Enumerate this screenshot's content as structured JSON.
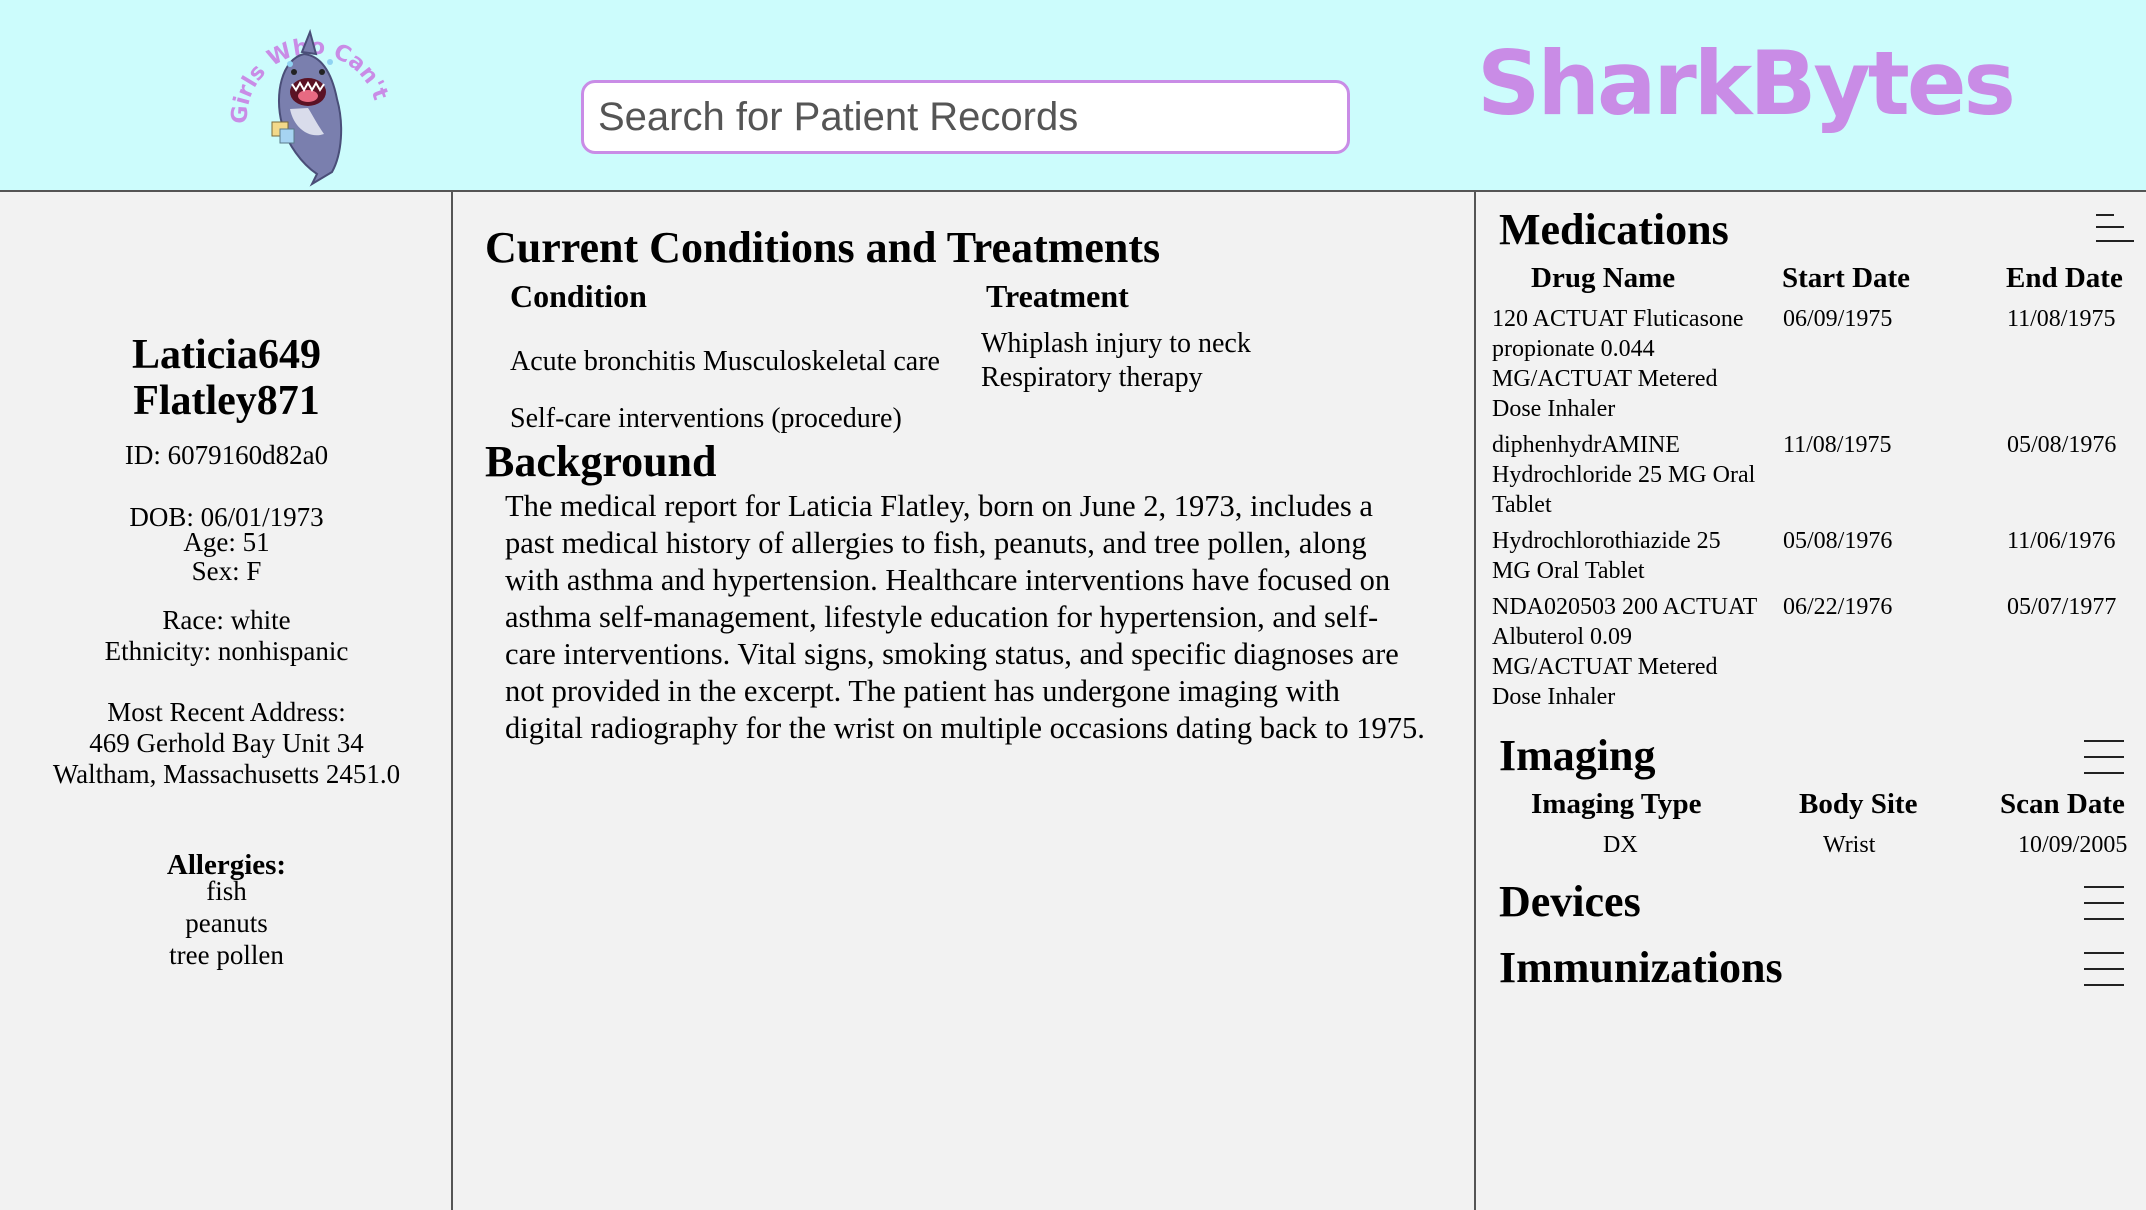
{
  "header": {
    "logo_text": "Girls Who Can't Code",
    "search_placeholder": "Search for Patient Records",
    "brand": "SharkBytes",
    "brand_color": "#c98ce6",
    "background": "#ccfcfc"
  },
  "patient": {
    "name_line1": "Laticia649",
    "name_line2": "Flatley871",
    "id": "ID: 6079160d82a0",
    "dob": "DOB: 06/01/1973",
    "age": "Age: 51",
    "sex": "Sex: F",
    "race": "Race: white",
    "ethnicity": "Ethnicity: nonhispanic",
    "address_label": "Most Recent Address:",
    "address_line1": "469 Gerhold Bay Unit 34",
    "address_line2": "Waltham, Massachusetts 2451.0",
    "allergies_label": "Allergies:",
    "allergies": [
      "fish",
      "peanuts",
      "tree pollen"
    ]
  },
  "conditions": {
    "title": "Current Conditions and Treatments",
    "col_condition": "Condition",
    "col_treatment": "Treatment",
    "condition_1": "Acute bronchitis Musculoskeletal care",
    "treatment_1a": "Whiplash injury to neck",
    "treatment_1b": "Respiratory therapy",
    "condition_2": "Self-care interventions (procedure)"
  },
  "background": {
    "title": "Background",
    "text": "The medical report for Laticia Flatley, born on June 2, 1973, includes a past medical history of allergies to fish, peanuts, and tree pollen, along with asthma and hypertension. Healthcare interventions have focused on asthma self-management, lifestyle education for hypertension, and self-care interventions. Vital signs, smoking status, and specific diagnoses are not provided in the excerpt. The patient has undergone imaging with digital radiography for the wrist on multiple occasions dating back to 1975."
  },
  "medications": {
    "title": "Medications",
    "menu_icon": "collapse-menu-icon",
    "col_drug": "Drug Name",
    "col_start": "Start Date",
    "col_end": "End Date",
    "rows": [
      {
        "drug": "120 ACTUAT Fluticasone propionate 0.044 MG/ACTUAT Metered Dose Inhaler",
        "start": "06/09/1975",
        "end": "11/08/1975"
      },
      {
        "drug": "diphenhydrAMINE Hydrochloride 25 MG Oral Tablet",
        "start": "11/08/1975",
        "end": "05/08/1976"
      },
      {
        "drug": "Hydrochlorothiazide 25 MG Oral Tablet",
        "start": "05/08/1976",
        "end": "11/06/1976"
      },
      {
        "drug": "NDA020503 200 ACTUAT Albuterol 0.09 MG/ACTUAT Metered Dose Inhaler",
        "start": "06/22/1976",
        "end": "05/07/1977"
      }
    ]
  },
  "imaging": {
    "title": "Imaging",
    "menu_icon": "hamburger-menu-icon",
    "col_type": "Imaging Type",
    "col_site": "Body Site",
    "col_date": "Scan Date",
    "rows": [
      {
        "type": "DX",
        "site": "Wrist",
        "date": "10/09/2005"
      }
    ]
  },
  "devices": {
    "title": "Devices",
    "menu_icon": "hamburger-menu-icon"
  },
  "immunizations": {
    "title": "Immunizations",
    "menu_icon": "hamburger-menu-icon"
  }
}
